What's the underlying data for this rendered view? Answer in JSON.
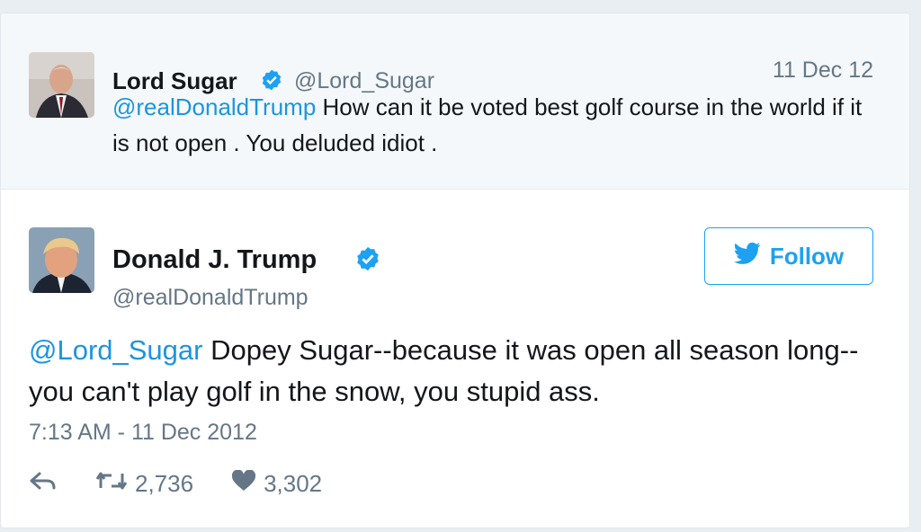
{
  "parent_tweet": {
    "name": "Lord Sugar",
    "handle": "@Lord_Sugar",
    "date": "11 Dec 12",
    "mention": "@realDonaldTrump",
    "text": " How can it be voted best golf course in the world if it is not open . You deluded idiot ."
  },
  "main_tweet": {
    "name": "Donald J. Trump",
    "handle": "@realDonaldTrump",
    "follow_label": "Follow",
    "mention": "@Lord_Sugar",
    "text": " Dopey Sugar--because it was open all season long--you can't play golf in the snow, you stupid ass.",
    "timestamp": "7:13 AM - 11 Dec 2012",
    "retweets": "2,736",
    "likes": "3,302"
  },
  "colors": {
    "accent": "#1da1f2",
    "mention": "#1b95e0",
    "muted": "#657786"
  },
  "icons": [
    "verified-icon",
    "twitter-bird-icon",
    "reply-icon",
    "retweet-icon",
    "heart-icon"
  ]
}
